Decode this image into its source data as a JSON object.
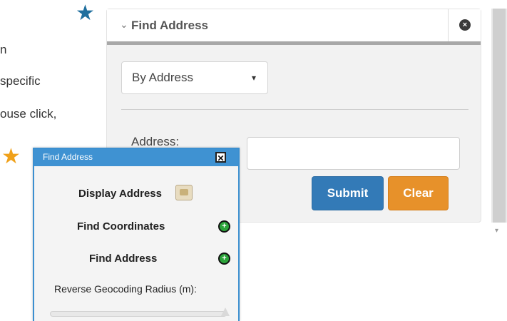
{
  "background_text": {
    "line1": "n",
    "line2": "specific",
    "line3": "ouse click,"
  },
  "icons": {
    "star_blue": "★",
    "star_orange": "★"
  },
  "panel": {
    "title": "Find Address",
    "chevron": "⌄",
    "close_symbol": "×",
    "mode_select": {
      "value": "By Address",
      "caret": "▾"
    },
    "address_label": "Address:",
    "address_value": "",
    "submit_label": "Submit",
    "clear_label": "Clear",
    "colors": {
      "submit": "#337ab7",
      "clear": "#e7912a"
    }
  },
  "dialog": {
    "title": "Find Address",
    "close_symbol": "✕",
    "display_address_label": "Display Address",
    "find_coordinates_label": "Find Coordinates",
    "find_address_label": "Find Address",
    "plus_symbol": "+",
    "radius_label": "Reverse Geocoding Radius (m):",
    "titlebar_color": "#3f92d2"
  },
  "scrollbar": {
    "arrow": "▾"
  }
}
